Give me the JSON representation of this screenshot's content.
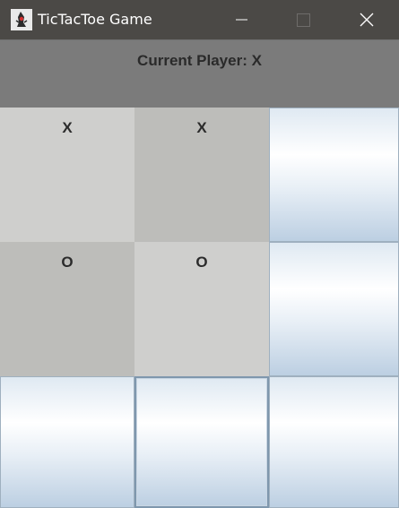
{
  "window": {
    "title": "TicTacToe Game",
    "icon": "java-duke-icon"
  },
  "status": {
    "current_player_text": "Current Player: X"
  },
  "board": {
    "cells": [
      {
        "row": 0,
        "col": 0,
        "mark": "X",
        "state": "played"
      },
      {
        "row": 0,
        "col": 1,
        "mark": "X",
        "state": "played"
      },
      {
        "row": 0,
        "col": 2,
        "mark": "",
        "state": "empty"
      },
      {
        "row": 1,
        "col": 0,
        "mark": "O",
        "state": "played"
      },
      {
        "row": 1,
        "col": 1,
        "mark": "O",
        "state": "played"
      },
      {
        "row": 1,
        "col": 2,
        "mark": "",
        "state": "empty"
      },
      {
        "row": 2,
        "col": 0,
        "mark": "",
        "state": "empty"
      },
      {
        "row": 2,
        "col": 1,
        "mark": "",
        "state": "empty",
        "focused": true
      },
      {
        "row": 2,
        "col": 2,
        "mark": "",
        "state": "empty"
      }
    ]
  },
  "colors": {
    "titlebar": "#4b4946",
    "header_panel": "#7b7b7b",
    "played_light": "#cfcfcd",
    "played_dark": "#bdbdba",
    "empty_gradient_bottom": "#bccfe2"
  }
}
